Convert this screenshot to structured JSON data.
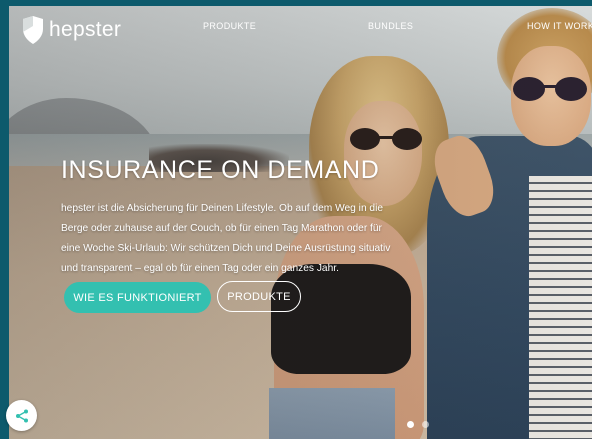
{
  "brand": {
    "name": "hepster",
    "logo_icon": "shield-logo-icon"
  },
  "nav": {
    "items": [
      {
        "label": "PRODUKTE"
      },
      {
        "label": "BUNDLES"
      },
      {
        "label": "HOW IT WORKS"
      }
    ]
  },
  "hero": {
    "headline": "INSURANCE ON DEMAND",
    "body": "hepster ist die Absicherung für Deinen Lifestyle. Ob auf dem Weg in die Berge oder zuhause auf der Couch, ob für einen Tag Marathon oder für eine Woche Ski-Urlaub: Wir schützen Dich und Deine Ausrüstung situativ und transparent – egal ob für einen Tag oder ein ganzes Jahr.",
    "primary_button": "WIE ES FUNKTIONIERT",
    "secondary_button": "PRODUKTE"
  },
  "share": {
    "icon": "share-icon"
  },
  "carousel": {
    "total_dots": 2,
    "active_index": 0
  },
  "colors": {
    "accent": "#33c0b0",
    "frame": "#0d5a6c",
    "text": "#ffffff"
  }
}
